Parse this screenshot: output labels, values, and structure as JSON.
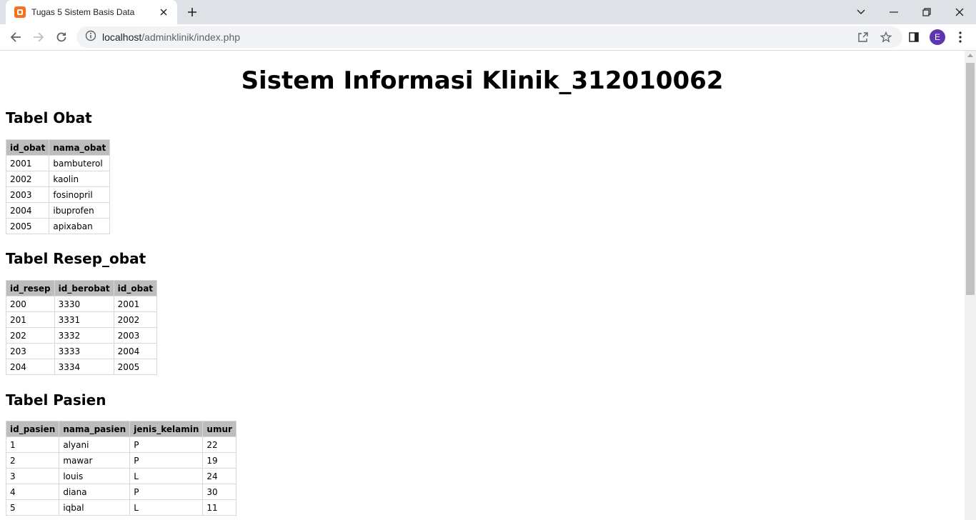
{
  "browser": {
    "tab_title": "Tugas 5 Sistem Basis Data",
    "url_host": "localhost",
    "url_path": "/adminklinik/index.php",
    "profile_initial": "E"
  },
  "page": {
    "title": "Sistem Informasi Klinik_312010062",
    "obat": {
      "heading": "Tabel Obat",
      "columns": [
        "id_obat",
        "nama_obat"
      ],
      "rows": [
        [
          "2001",
          "bambuterol"
        ],
        [
          "2002",
          "kaolin"
        ],
        [
          "2003",
          "fosinopril"
        ],
        [
          "2004",
          "ibuprofen"
        ],
        [
          "2005",
          "apixaban"
        ]
      ]
    },
    "resep": {
      "heading": "Tabel Resep_obat",
      "columns": [
        "id_resep",
        "id_berobat",
        "id_obat"
      ],
      "rows": [
        [
          "200",
          "3330",
          "2001"
        ],
        [
          "201",
          "3331",
          "2002"
        ],
        [
          "202",
          "3332",
          "2003"
        ],
        [
          "203",
          "3333",
          "2004"
        ],
        [
          "204",
          "3334",
          "2005"
        ]
      ]
    },
    "pasien": {
      "heading": "Tabel Pasien",
      "columns": [
        "id_pasien",
        "nama_pasien",
        "jenis_kelamin",
        "umur"
      ],
      "rows": [
        [
          "1",
          "alyani",
          "P",
          "22"
        ],
        [
          "2",
          "mawar",
          "P",
          "19"
        ],
        [
          "3",
          "louis",
          "L",
          "24"
        ],
        [
          "4",
          "diana",
          "P",
          "30"
        ],
        [
          "5",
          "iqbal",
          "L",
          "11"
        ]
      ]
    }
  },
  "colors": {
    "tabstrip": "#dee1e6",
    "favicon": "#f7701c",
    "avatar": "#5e35b1",
    "table_header": "#bdbdbd"
  }
}
